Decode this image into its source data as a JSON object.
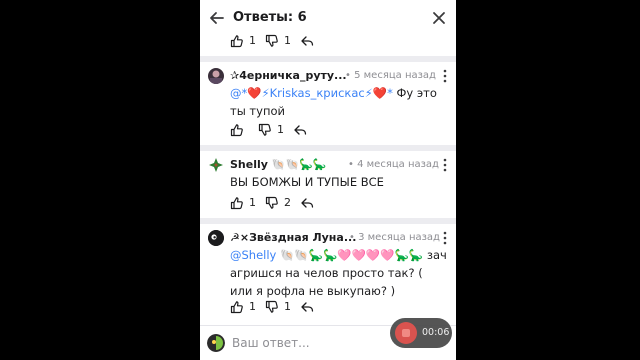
{
  "header": {
    "title": "Ответы: 6",
    "back_icon": "arrow-left-icon",
    "close_icon": "close-icon"
  },
  "root_actions": {
    "likes": "1",
    "dislikes": "1"
  },
  "comments": [
    {
      "username": "✰4ерничка_руту...",
      "time": "• 5 месяца назад",
      "mention": "@*❤️⚡Kriskas_крискас⚡❤️*",
      "text": " Фу это ты тупой",
      "likes": "",
      "dislikes": "1"
    },
    {
      "username": "Shelly 🐚🐚🦕🦕",
      "time": "• 4 месяца назад",
      "mention": "",
      "text": "ВЫ БОМЖЫ И ТУПЫЕ ВСЕ",
      "likes": "1",
      "dislikes": "2"
    },
    {
      "username": "☭×Звёздная Луна...",
      "time": "• 3 месяца назад",
      "mention": "@Shelly 🐚🐚🦕🦕🩷🩷🩷🩷🦕🦕",
      "text": " зач агришся на челов просто так? ( или я рофла не выкупаю? )",
      "likes": "1",
      "dislikes": "1"
    }
  ],
  "composer": {
    "placeholder": "Ваш ответ..."
  },
  "recorder": {
    "time": "00:06"
  },
  "colors": {
    "mention": "#3b82f6",
    "divider": "#ececf0",
    "background": "#000000"
  }
}
